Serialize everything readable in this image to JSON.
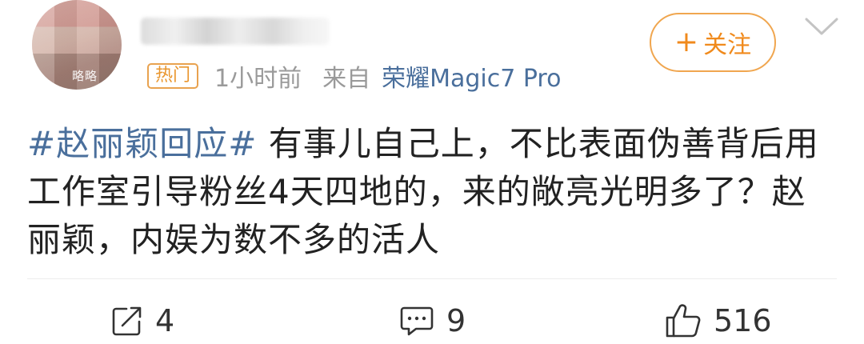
{
  "author": {
    "avatar_watermark": "略略",
    "avatar_icon": "blurred-avatar-icon"
  },
  "meta": {
    "hot_badge": "热门",
    "time": "1小时前",
    "from_label": "来自",
    "device": "荣耀Magic7 Pro"
  },
  "follow": {
    "plus": "+",
    "label": "关注"
  },
  "post": {
    "topic": "#赵丽颖回应#",
    "text": " 有事儿自己上，不比表面伪善背后用工作室引导粉丝4天四地的，来的敞亮光明多了？赵丽颖，内娱为数不多的活人"
  },
  "actions": {
    "repost_count": "4",
    "comment_count": "9",
    "like_count": "516"
  },
  "colors": {
    "accent_orange": "#f08a1c",
    "link_blue": "#4a6f9c",
    "meta_gray": "#9a9a9a"
  }
}
